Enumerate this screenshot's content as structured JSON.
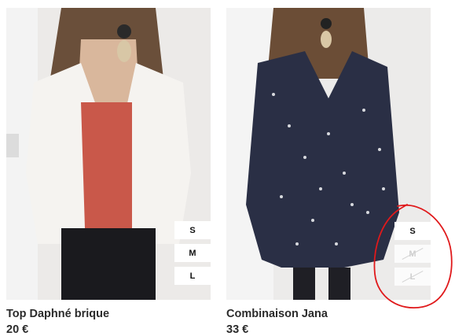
{
  "products": [
    {
      "name": "Top Daphné brique",
      "price": "20 €",
      "sizes": [
        {
          "label": "S",
          "available": true
        },
        {
          "label": "M",
          "available": true
        },
        {
          "label": "L",
          "available": true
        }
      ]
    },
    {
      "name": "Combinaison Jana",
      "price": "33 €",
      "sizes": [
        {
          "label": "S",
          "available": true
        },
        {
          "label": "M",
          "available": false
        },
        {
          "label": "L",
          "available": false
        }
      ]
    }
  ],
  "colors": {
    "annotation": "#e0191b",
    "top_fabric": "#c9584a",
    "cardigan": "#f4f1ee",
    "dress_print": "#2a2f45"
  }
}
